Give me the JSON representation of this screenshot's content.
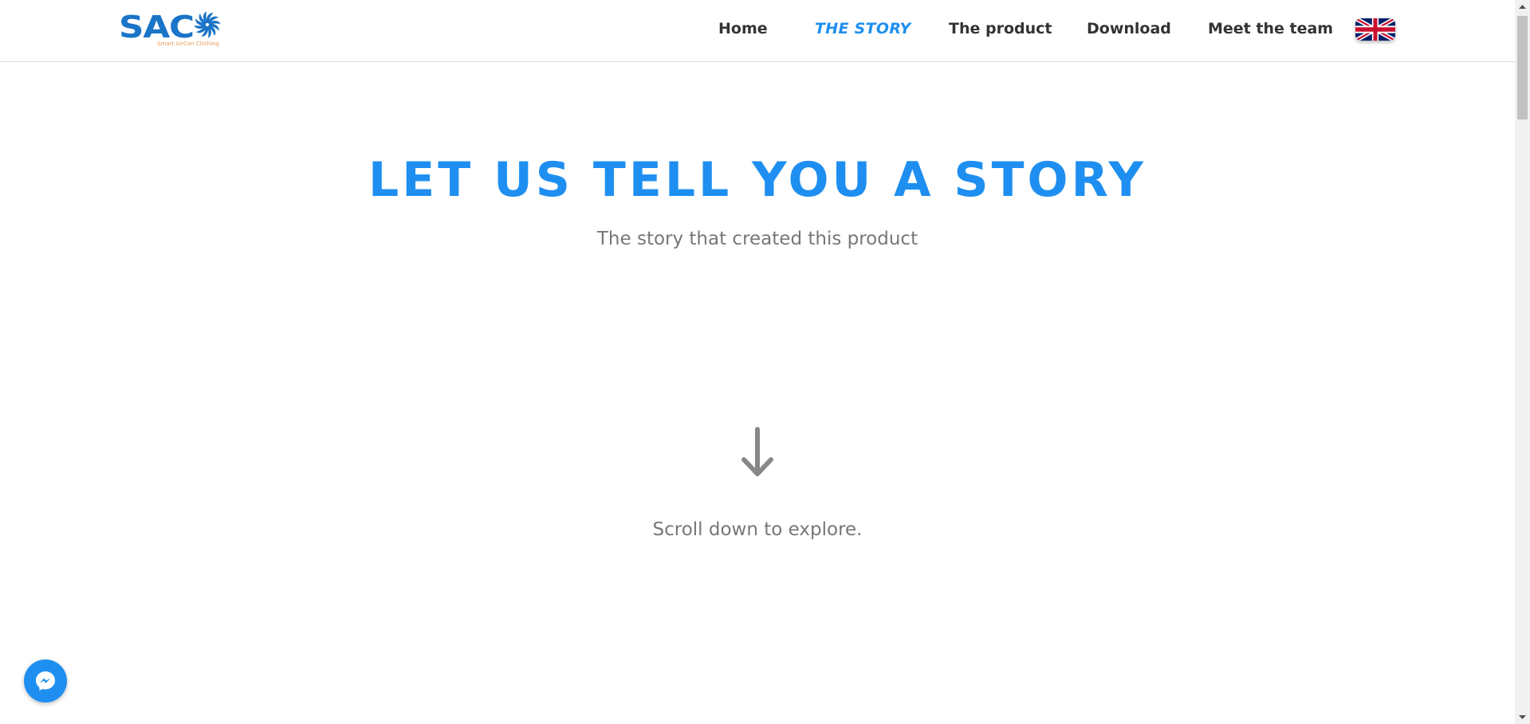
{
  "header": {
    "logo": {
      "text": "SAC",
      "tagline": "Smart AirCon Clothing"
    },
    "nav": {
      "home": "Home",
      "story": "THE STORY",
      "product": "The product",
      "download": "Download",
      "team": "Meet the team"
    },
    "language_flag": "uk-flag-icon"
  },
  "hero": {
    "title": "Let us tell you a story",
    "subtitle": "The story that created this product",
    "scroll_icon": "arrow-down-icon",
    "scroll_text": "Scroll down to explore."
  },
  "chat": {
    "icon": "messenger-icon"
  },
  "colors": {
    "accent": "#1e8ff0",
    "logo": "#1a74c8",
    "logo_tagline": "#e89a57",
    "text_dark": "#333333",
    "text_muted": "#777777"
  }
}
